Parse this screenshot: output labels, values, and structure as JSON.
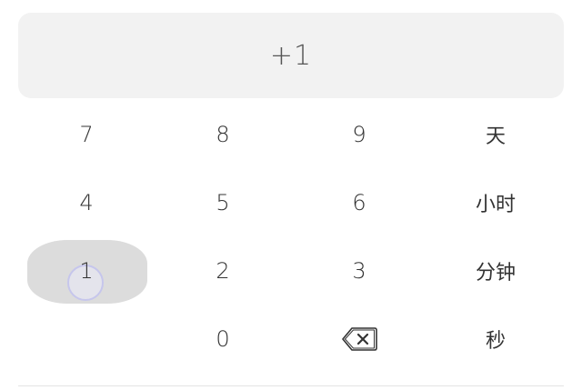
{
  "display": {
    "value": "+1"
  },
  "keypad": {
    "row1": [
      "7",
      "8",
      "9",
      "天"
    ],
    "row2": [
      "4",
      "5",
      "6",
      "小时"
    ],
    "row3": [
      "1",
      "2",
      "3",
      "分钟"
    ],
    "row4": [
      "0",
      "秒"
    ],
    "backspace_icon": "backspace-icon",
    "pressed_key": "1"
  },
  "colors": {
    "display_bg": "#f2f2f2",
    "pressed_bg": "#dcdcdc",
    "touch_ring": "#c6c6ec",
    "text": "#333333"
  }
}
